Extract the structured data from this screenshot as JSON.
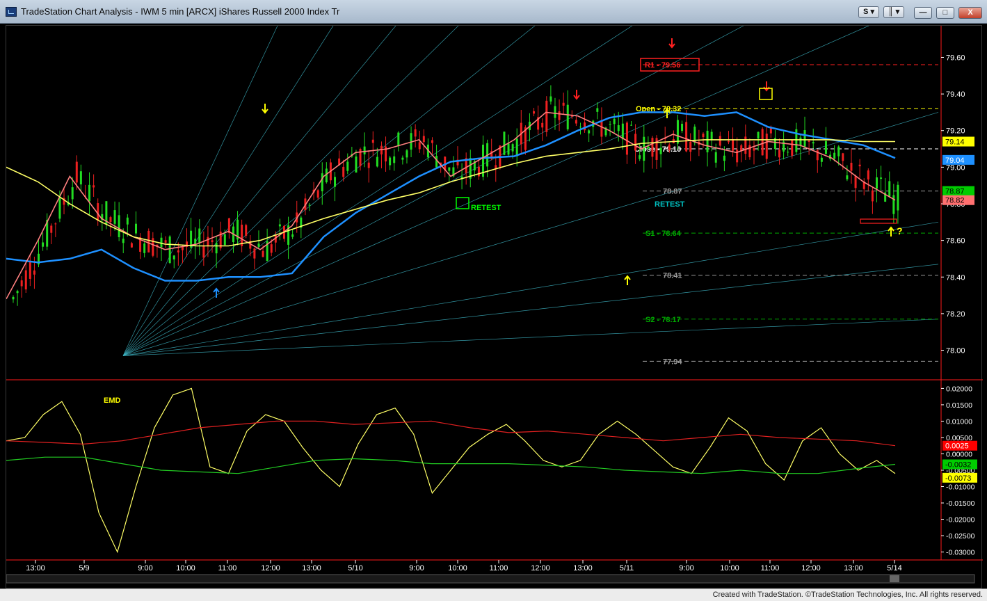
{
  "window": {
    "title": "TradeStation Chart Analysis - IWM 5 min [ARCX] iShares Russell 2000 Index Tr",
    "buttons": {
      "s_label": "S",
      "link_label": "║",
      "minimize": "—",
      "maximize": "□",
      "close": "X"
    }
  },
  "footer": {
    "text": "Created with TradeStation. ©TradeStation Technologies, Inc. All rights reserved."
  },
  "chart_data": [
    {
      "type": "line",
      "title": "",
      "xlabel": "",
      "ylabel": "",
      "ylim": [
        77.85,
        79.75
      ],
      "y_ticks": [
        "79.60",
        "79.40",
        "79.20",
        "79.00",
        "78.80",
        "78.60",
        "78.40",
        "78.20",
        "78.00"
      ],
      "x_ticks": [
        "13:00",
        "5/9",
        "9:00",
        "10:00",
        "11:00",
        "12:00",
        "13:00",
        "5/10",
        "9:00",
        "10:00",
        "11:00",
        "12:00",
        "13:00",
        "5/11",
        "9:00",
        "10:00",
        "11:00",
        "12:00",
        "13:00",
        "5/14"
      ],
      "price_badges": [
        {
          "label": "79.14",
          "value": 79.14,
          "color": "#ffff00",
          "text_color": "#000000"
        },
        {
          "label": "79.04",
          "value": 79.04,
          "color": "#1e90ff",
          "text_color": "#ffffff"
        },
        {
          "label": "78.87",
          "value": 78.87,
          "color": "#00cc00",
          "text_color": "#000000"
        },
        {
          "label": "78.82",
          "value": 78.82,
          "color": "#ff7070",
          "text_color": "#000000"
        }
      ],
      "levels": [
        {
          "label": "R1 - 79.56",
          "value": 79.56,
          "color": "#ff2020"
        },
        {
          "label": "Open - 79.32",
          "value": 79.32,
          "color": "#ffff00"
        },
        {
          "label": "Close - 79.10",
          "value": 79.1,
          "color": "#ffffff"
        },
        {
          "label": "78.87",
          "value": 78.87,
          "color": "#9a9a9a"
        },
        {
          "label": "S1 - 78.64",
          "value": 78.64,
          "color": "#00aa00"
        },
        {
          "label": "78.41",
          "value": 78.41,
          "color": "#9a9a9a"
        },
        {
          "label": "S2 - 78.17",
          "value": 78.17,
          "color": "#00aa00"
        },
        {
          "label": "77.94",
          "value": 77.94,
          "color": "#9a9a9a"
        }
      ],
      "annotations": [
        {
          "text": "RETEST",
          "color": "#00ff00"
        },
        {
          "text": "RETEST",
          "color": "#00bfbf"
        },
        {
          "text": "?",
          "color": "#ffff00"
        }
      ],
      "series": [
        {
          "name": "",
          "color": "#1e90ff",
          "values": [
            78.5,
            78.48,
            78.5,
            78.55,
            78.45,
            78.38,
            78.38,
            78.4,
            78.4,
            78.42,
            78.62,
            78.75,
            78.85,
            78.95,
            79.03,
            79.05,
            79.06,
            79.12,
            79.2,
            79.27,
            79.3,
            79.3,
            79.28,
            79.3,
            79.22,
            79.18,
            79.15,
            79.12,
            79.05
          ]
        },
        {
          "name": "",
          "color": "#ff8080",
          "values": [
            78.28,
            78.6,
            78.95,
            78.72,
            78.62,
            78.55,
            78.58,
            78.65,
            78.55,
            78.68,
            78.95,
            79.08,
            79.1,
            79.15,
            78.95,
            79.05,
            79.15,
            79.3,
            79.28,
            79.2,
            79.1,
            79.18,
            79.12,
            79.08,
            79.14,
            79.12,
            79.05,
            78.92,
            78.82
          ]
        },
        {
          "name": "",
          "color": "#ffff66",
          "values": [
            79.0,
            78.92,
            78.8,
            78.7,
            78.62,
            78.58,
            78.57,
            78.57,
            78.6,
            78.66,
            78.72,
            78.77,
            78.82,
            78.86,
            78.92,
            78.97,
            79.02,
            79.06,
            79.08,
            79.1,
            79.13,
            79.14,
            79.15,
            79.15,
            79.15,
            79.15,
            79.15,
            79.14,
            79.14
          ]
        }
      ]
    },
    {
      "type": "line",
      "title": "",
      "label": "EMD",
      "xlabel": "",
      "ylabel": "",
      "ylim": [
        -0.032,
        0.022
      ],
      "y_ticks": [
        "0.02000",
        "0.01500",
        "0.01000",
        "0.00500",
        "0.00000",
        "-0.00500",
        "-0.01000",
        "-0.01500",
        "-0.02000",
        "-0.02500",
        "-0.03000"
      ],
      "price_badges": [
        {
          "label": "0.0025",
          "value": 0.0025,
          "color": "#ff0000",
          "text_color": "#ffffff"
        },
        {
          "label": "-0.0032",
          "value": -0.0032,
          "color": "#00cc00",
          "text_color": "#000000"
        },
        {
          "label": "-0.0073",
          "value": -0.0073,
          "color": "#ffff00",
          "text_color": "#000000"
        }
      ],
      "series": [
        {
          "name": "EMD",
          "color": "#ffff66",
          "values": [
            0.004,
            0.005,
            0.012,
            0.016,
            0.006,
            -0.018,
            -0.03,
            -0.01,
            0.008,
            0.018,
            0.02,
            -0.004,
            -0.006,
            0.007,
            0.012,
            0.01,
            0.002,
            -0.005,
            -0.01,
            0.003,
            0.012,
            0.014,
            0.006,
            -0.012,
            -0.005,
            0.002,
            0.006,
            0.009,
            0.004,
            -0.002,
            -0.004,
            -0.002,
            0.006,
            0.01,
            0.006,
            0.001,
            -0.004,
            -0.006,
            0.002,
            0.011,
            0.007,
            -0.003,
            -0.008,
            0.004,
            0.008,
            0.0,
            -0.005,
            -0.002,
            -0.006
          ]
        },
        {
          "name": "",
          "color": "#e02020",
          "values": [
            0.004,
            0.0035,
            0.003,
            0.004,
            0.006,
            0.008,
            0.009,
            0.01,
            0.01,
            0.009,
            0.0095,
            0.01,
            0.008,
            0.0065,
            0.007,
            0.006,
            0.005,
            0.004,
            0.005,
            0.006,
            0.005,
            0.0045,
            0.004,
            0.0025
          ]
        },
        {
          "name": "",
          "color": "#22cc22",
          "values": [
            -0.002,
            -0.001,
            -0.001,
            -0.003,
            -0.005,
            -0.0055,
            -0.006,
            -0.004,
            -0.002,
            -0.0015,
            -0.002,
            -0.003,
            -0.003,
            -0.003,
            -0.0035,
            -0.004,
            -0.005,
            -0.0055,
            -0.006,
            -0.005,
            -0.006,
            -0.006,
            -0.0045,
            -0.0032
          ]
        }
      ]
    }
  ],
  "colors": {
    "background": "#000000",
    "axis_text": "#ffffff",
    "separator_red": "#ff1a1a",
    "fan_line": "#3fb9c9"
  },
  "icons": [
    "app-chart-icon",
    "arrow-up-icon",
    "arrow-down-icon"
  ]
}
